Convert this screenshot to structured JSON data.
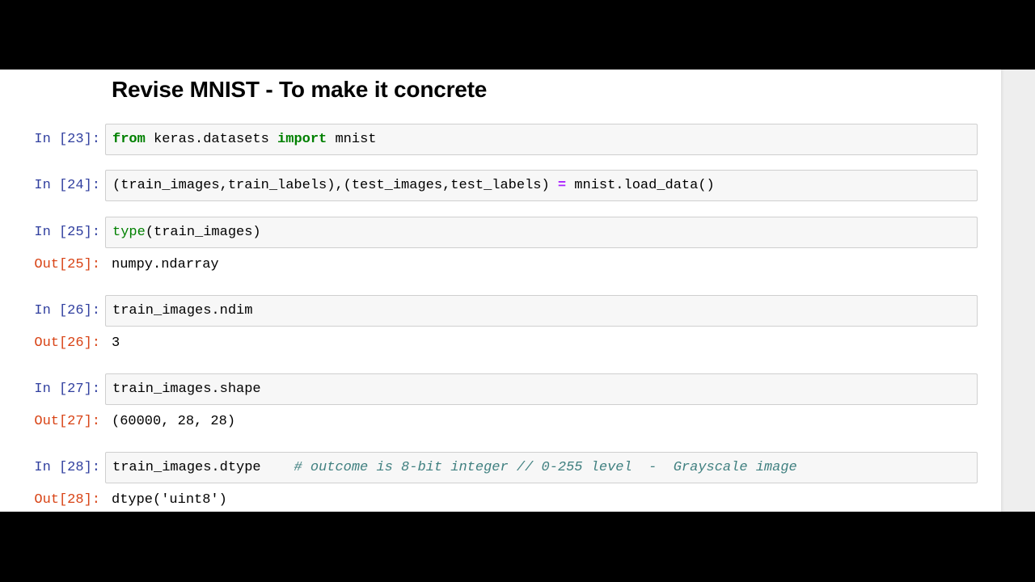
{
  "notebook": {
    "heading": "Revise MNIST - To make it concrete",
    "cells": [
      {
        "in_prompt": "In [23]:",
        "code": {
          "kw1": "from",
          "mod": " keras.datasets ",
          "kw2": "import",
          "name": " mnist"
        }
      },
      {
        "in_prompt": "In [24]:",
        "code": {
          "lhs": "(train_images,train_labels),(test_images,test_labels) ",
          "op": "=",
          "rhs": " mnist.load_data()"
        }
      },
      {
        "in_prompt": "In [25]:",
        "code": {
          "builtin": "type",
          "args": "(train_images)"
        },
        "out_prompt": "Out[25]:",
        "output": "numpy.ndarray"
      },
      {
        "in_prompt": "In [26]:",
        "code": {
          "text": "train_images.ndim"
        },
        "out_prompt": "Out[26]:",
        "output": "3"
      },
      {
        "in_prompt": "In [27]:",
        "code": {
          "text": "train_images.shape"
        },
        "out_prompt": "Out[27]:",
        "output": "(60000, 28, 28)"
      },
      {
        "in_prompt": "In [28]:",
        "code": {
          "text": "train_images.dtype    ",
          "comment": "# outcome is 8-bit integer // 0-255 level  -  Grayscale image"
        },
        "out_prompt": "Out[28]:",
        "output": "dtype('uint8')"
      }
    ]
  },
  "colors": {
    "in_prompt": "#303f9f",
    "out_prompt": "#d84315",
    "keyword": "#008000",
    "operator": "#aa22ff",
    "comment": "#408080",
    "cell_background": "#f7f7f7",
    "letterbox": "#000000"
  }
}
